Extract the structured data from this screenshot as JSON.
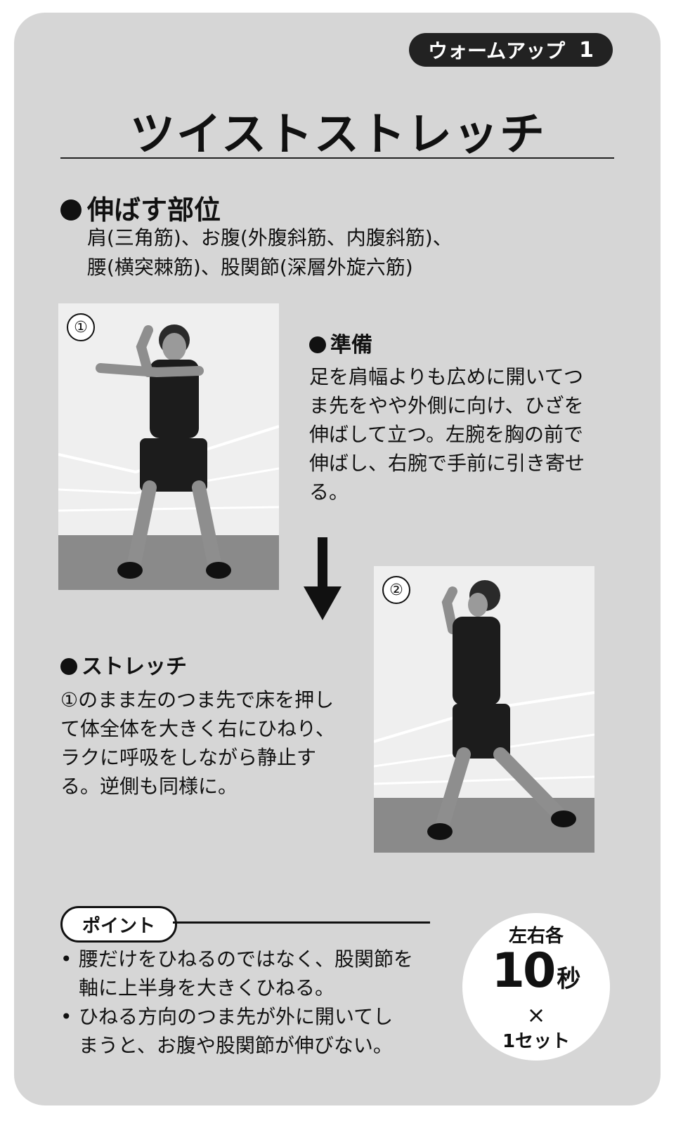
{
  "tag": {
    "label": "ウォームアップ",
    "number": "1"
  },
  "title": "ツイストストレッチ",
  "target": {
    "heading": "伸ばす部位",
    "lines": [
      "肩(三角筋)、お腹(外腹斜筋、内腹斜筋)、",
      "腰(横突棘筋)、股関節(深層外旋六筋)"
    ]
  },
  "step1": {
    "badge": "①",
    "heading": "準備",
    "lines": [
      "足を肩幅よりも広めに開いてつ",
      "ま先をやや外側に向け、ひざを",
      "伸ばして立つ。左腕を胸の前で",
      "伸ばし、右腕で手前に引き寄せ",
      "る。"
    ]
  },
  "step2": {
    "badge": "②",
    "heading": "ストレッチ",
    "lines": [
      "①のまま左のつま先で床を押し",
      "て体全体を大きく右にひねり、",
      "ラクに呼吸をしながら静止す",
      "る。逆側も同様に。"
    ]
  },
  "point": {
    "label": "ポイント",
    "items": [
      [
        "腰だけをひねるのではなく、股関節を",
        "軸に上半身を大きくひねる。"
      ],
      [
        "ひねる方向のつま先が外に開いてし",
        "まうと、お腹や股関節が伸びない。"
      ]
    ]
  },
  "reps": {
    "top": "左右各",
    "count": "10",
    "unit": "秒",
    "times": "×",
    "sets": "1セット"
  },
  "colors": {
    "card": "#d6d6d6",
    "ink": "#111111",
    "tag_bg": "#222222"
  }
}
